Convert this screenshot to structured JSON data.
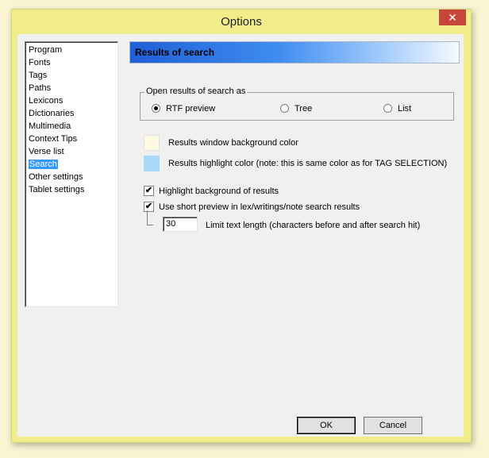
{
  "window": {
    "title": "Options",
    "close_glyph": "✕"
  },
  "sidebar": {
    "items": [
      {
        "label": "Program"
      },
      {
        "label": "Fonts"
      },
      {
        "label": "Tags"
      },
      {
        "label": "Paths"
      },
      {
        "label": "Lexicons"
      },
      {
        "label": "Dictionaries"
      },
      {
        "label": "Multimedia"
      },
      {
        "label": "Context Tips"
      },
      {
        "label": "Verse list"
      },
      {
        "label": "Search",
        "selected": true
      },
      {
        "label": "Other settings"
      },
      {
        "label": "Tablet settings"
      }
    ]
  },
  "panel": {
    "header": "Results of search",
    "open_group": {
      "legend": "Open results of search as",
      "options": [
        {
          "label": "RTF preview",
          "checked": true
        },
        {
          "label": "Tree",
          "checked": false
        },
        {
          "label": "List",
          "checked": false
        }
      ]
    },
    "colors": [
      {
        "label": "Results window background color",
        "color": "#fffbe3"
      },
      {
        "label": "Results highlight color (note: this is same color as for TAG SELECTION)",
        "color": "#a7d8f8"
      }
    ],
    "checks": [
      {
        "label": "Highlight background of results",
        "checked": true,
        "mark": "✔"
      },
      {
        "label": "Use short preview in lex/writings/note search results",
        "checked": true,
        "mark": "✔"
      }
    ],
    "limit": {
      "value": "30",
      "label": "Limit text length (characters before and after search hit)"
    }
  },
  "buttons": {
    "ok": "OK",
    "cancel": "Cancel"
  }
}
